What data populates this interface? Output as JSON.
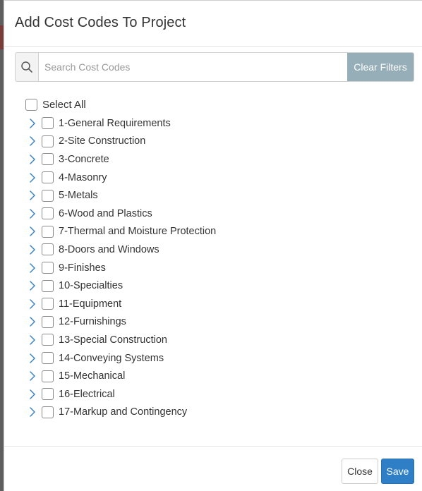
{
  "modal": {
    "title": "Add Cost Codes To Project"
  },
  "search": {
    "placeholder": "Search Cost Codes",
    "value": "",
    "icon": "search-icon",
    "clear_label": "Clear Filters"
  },
  "tree": {
    "select_all_label": "Select All",
    "items": [
      {
        "label": "1-General Requirements"
      },
      {
        "label": "2-Site Construction"
      },
      {
        "label": "3-Concrete"
      },
      {
        "label": "4-Masonry"
      },
      {
        "label": "5-Metals"
      },
      {
        "label": "6-Wood and Plastics"
      },
      {
        "label": "7-Thermal and Moisture Protection"
      },
      {
        "label": "8-Doors and Windows"
      },
      {
        "label": "9-Finishes"
      },
      {
        "label": "10-Specialties"
      },
      {
        "label": "11-Equipment"
      },
      {
        "label": "12-Furnishings"
      },
      {
        "label": "13-Special Construction"
      },
      {
        "label": "14-Conveying Systems"
      },
      {
        "label": "15-Mechanical"
      },
      {
        "label": "16-Electrical"
      },
      {
        "label": "17-Markup and Contingency"
      }
    ]
  },
  "footer": {
    "close_label": "Close",
    "save_label": "Save"
  },
  "colors": {
    "accent": "#2e7fc6",
    "clear_button": "#95aeb7",
    "chevron": "#2e7fc6"
  }
}
